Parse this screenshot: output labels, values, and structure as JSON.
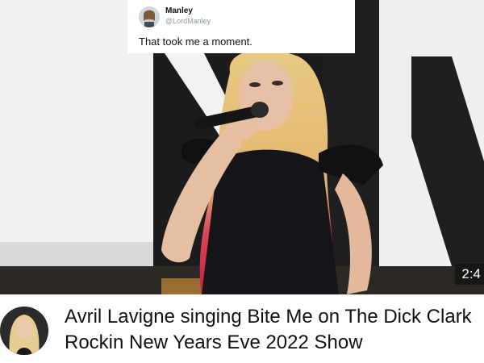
{
  "tweet": {
    "name": "Manley",
    "handle": "@LordManley",
    "text": "That took me a moment."
  },
  "video": {
    "time": "2:4",
    "title": "Avril Lavigne singing Bite Me on The Dick Clark Rockin New Years Eve 2022 Show"
  },
  "colors": {
    "hair_blonde": "#e6c57a",
    "hair_pink": "#d8304f",
    "stage_white": "#f2f2f2"
  }
}
